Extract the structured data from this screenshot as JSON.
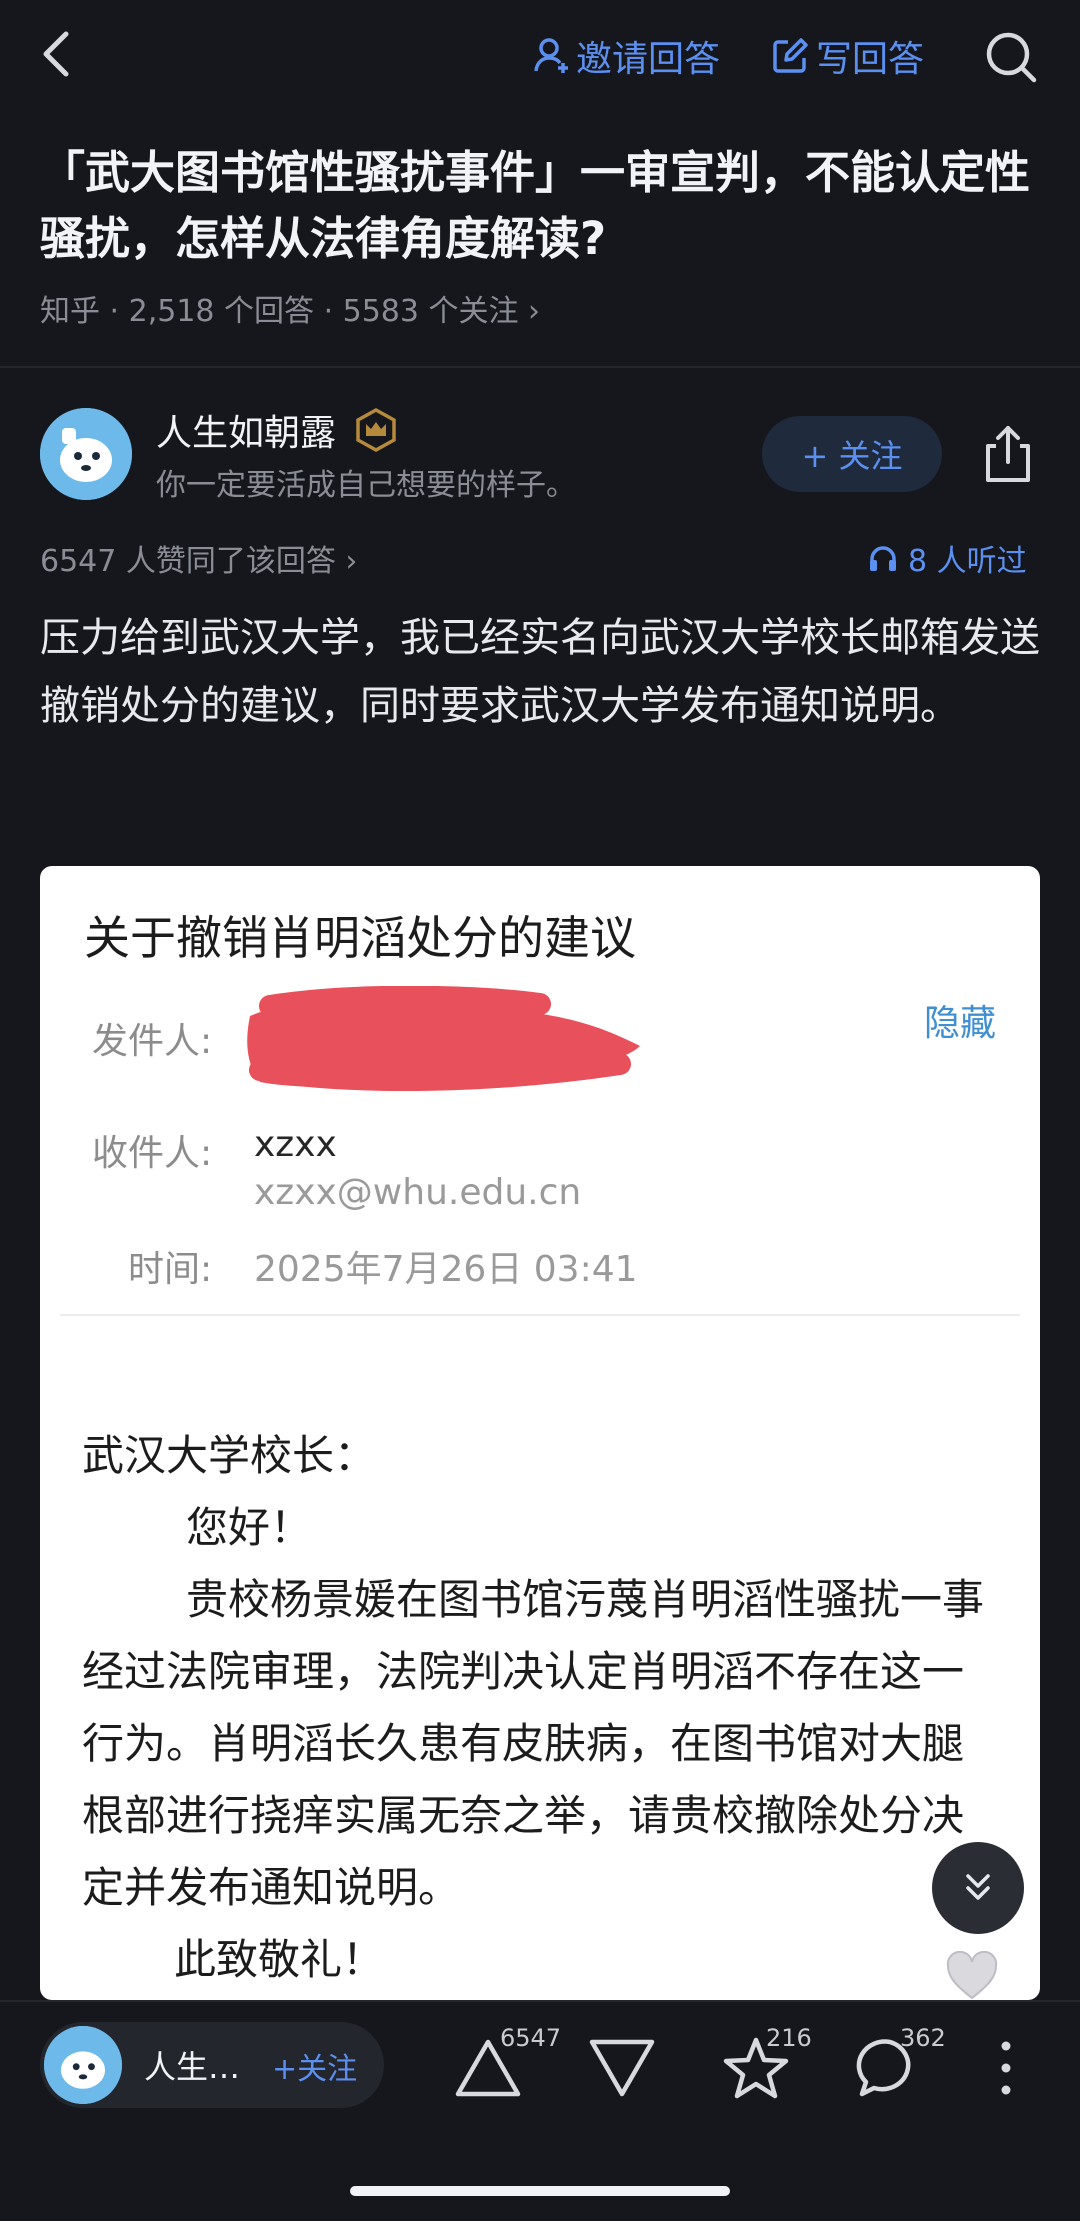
{
  "header": {
    "invite_label": "邀请回答",
    "write_label": "写回答"
  },
  "question": {
    "title": "「武大图书馆性骚扰事件」一审宣判，不能认定性骚扰，怎样从法律角度解读?",
    "meta": "知乎 · 2,518 个回答 · 5583 个关注 ›"
  },
  "author": {
    "name": "人生如朝露",
    "signature": "你一定要活成自己想要的样子。",
    "follow_label": "+ 关注"
  },
  "answer": {
    "likes_text": "6547 人赞同了该回答 ›",
    "listen_text": "8 人听过",
    "body": "压力给到武汉大学，我已经实名向武汉大学校长邮箱发送撤销处分的建议，同时要求武汉大学发布通知说明。"
  },
  "email": {
    "subject": "关于撤销肖明滔处分的建议",
    "sender_label": "发件人:",
    "hide_label": "隐藏",
    "recipient_label": "收件人:",
    "recipient_name": "xzxx",
    "recipient_email": "xzxx@whu.edu.cn",
    "time_label": "时间:",
    "time_value": "2025年7月26日 03:41",
    "salutation": "武汉大学校长：",
    "greeting": "您好！",
    "paragraph": "贵校杨景媛在图书馆污蔑肖明滔性骚扰一事经过法院审理，法院判决认定肖明滔不存在这一行为。肖明滔长久患有皮肤病，在图书馆对大腿根部进行挠痒实属无奈之举，请贵校撤除处分决定并发布通知说明。",
    "closing": "此致敬礼！"
  },
  "bottom": {
    "author_short": "人生…",
    "follow_label": "+关注",
    "upvote_count": "6547",
    "favorite_count": "216",
    "comment_count": "362"
  },
  "colors": {
    "background": "#16171c",
    "accent": "#5b8ff0",
    "card": "#ffffff",
    "redaction": "#e8505b"
  }
}
